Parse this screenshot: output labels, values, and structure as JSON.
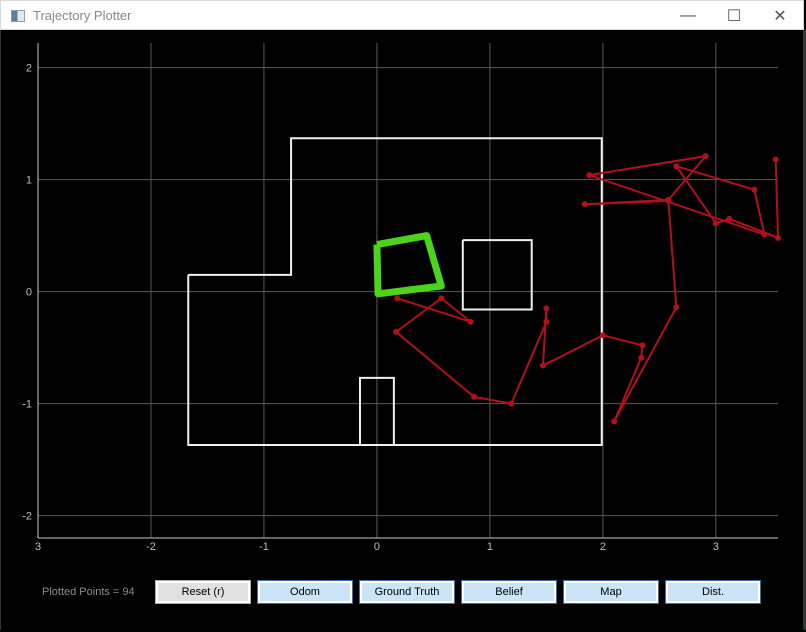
{
  "window": {
    "title": "Trajectory Plotter",
    "controls": {
      "minimize": "—",
      "maximize": "☐",
      "close": "✕"
    }
  },
  "status": {
    "plotted_points_label": "Plotted Points = 94"
  },
  "buttons": [
    {
      "id": "reset",
      "label": "Reset (r)"
    },
    {
      "id": "odom",
      "label": "Odom"
    },
    {
      "id": "ground-truth",
      "label": "Ground Truth"
    },
    {
      "id": "belief",
      "label": "Belief"
    },
    {
      "id": "map",
      "label": "Map"
    },
    {
      "id": "dist",
      "label": "Dist."
    }
  ],
  "colors": {
    "background": "#000000",
    "grid": "#5a5a5a",
    "axis": "#c8c8c8",
    "map": "#f0f0f0",
    "ground_truth": "#4cd41c",
    "odom": "#b0101c",
    "button_active": "#cce4f7",
    "button_reset": "#e1e1e1"
  },
  "chart_data": {
    "type": "line",
    "title": "",
    "xlabel": "",
    "ylabel": "",
    "xlim": [
      -3,
      3.55
    ],
    "ylim": [
      -2.2,
      2.22
    ],
    "grid": true,
    "x_ticks": [
      -3,
      -2,
      -1,
      0,
      1,
      2,
      3
    ],
    "x_tick_labels": [
      "3",
      "-2",
      "-1",
      "0",
      "1",
      "2",
      "3"
    ],
    "y_ticks": [
      -2,
      -1,
      0,
      1,
      2
    ],
    "y_tick_labels": [
      "-2",
      "-1",
      "0",
      "1",
      "2"
    ],
    "map_lines": [
      {
        "name": "outer-wall",
        "points": [
          [
            -1.67,
            0.15
          ],
          [
            -0.76,
            0.15
          ],
          [
            -0.76,
            1.37
          ],
          [
            1.99,
            1.37
          ],
          [
            1.99,
            -1.37
          ],
          [
            -1.67,
            -1.37
          ],
          [
            -1.67,
            0.15
          ]
        ]
      },
      {
        "name": "inner-box",
        "points": [
          [
            0.76,
            0.46
          ],
          [
            1.37,
            0.46
          ],
          [
            1.37,
            -0.16
          ],
          [
            0.76,
            -0.16
          ],
          [
            0.76,
            0.46
          ]
        ]
      },
      {
        "name": "small-box",
        "points": [
          [
            -0.15,
            -1.37
          ],
          [
            -0.15,
            -0.77
          ],
          [
            0.15,
            -0.77
          ],
          [
            0.15,
            -1.37
          ]
        ]
      }
    ],
    "series": [
      {
        "name": "Ground Truth",
        "points": [
          [
            0.0,
            0.42
          ],
          [
            0.44,
            0.5
          ],
          [
            0.57,
            0.05
          ],
          [
            0.01,
            -0.02
          ],
          [
            0.0,
            0.42
          ]
        ]
      },
      {
        "name": "Odom",
        "points": [
          [
            0.18,
            -0.06
          ],
          [
            0.83,
            -0.27
          ],
          [
            0.57,
            -0.06
          ],
          [
            0.17,
            -0.36
          ],
          [
            0.86,
            -0.94
          ],
          [
            1.19,
            -1.0
          ],
          [
            1.5,
            -0.27
          ],
          [
            1.5,
            -0.15
          ],
          [
            1.47,
            -0.66
          ],
          [
            2.0,
            -0.39
          ],
          [
            2.35,
            -0.48
          ],
          [
            2.34,
            -0.59
          ],
          [
            2.1,
            -1.16
          ],
          [
            2.65,
            -0.14
          ],
          [
            2.58,
            0.81
          ],
          [
            1.84,
            0.78
          ],
          [
            2.58,
            0.82
          ],
          [
            2.91,
            1.21
          ],
          [
            1.88,
            1.04
          ],
          [
            3.43,
            0.51
          ],
          [
            3.34,
            0.91
          ],
          [
            2.65,
            1.12
          ],
          [
            3.0,
            0.61
          ],
          [
            3.12,
            0.65
          ],
          [
            3.55,
            0.48
          ],
          [
            3.53,
            1.18
          ]
        ]
      }
    ]
  }
}
